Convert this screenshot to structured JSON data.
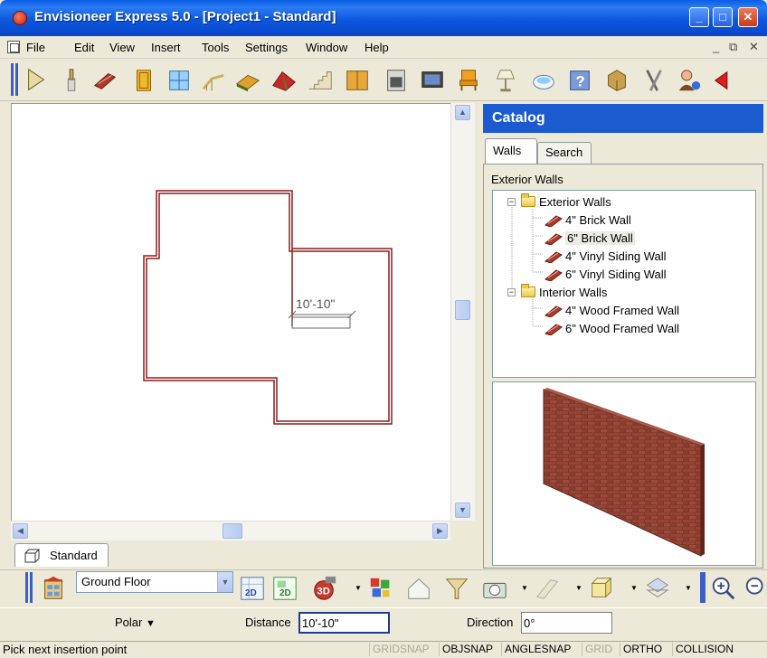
{
  "window": {
    "title": "Envisioneer Express 5.0 - [Project1 - Standard]",
    "minimize": "_",
    "maximize": "□",
    "close": "✕"
  },
  "menu": {
    "items": [
      "File",
      "Edit",
      "View",
      "Insert",
      "Tools",
      "Settings",
      "Window",
      "Help"
    ],
    "mdi_min": "_",
    "mdi_restore": "⧉",
    "mdi_close": "✕"
  },
  "toolbar": {
    "tools": [
      "select-arrow-icon",
      "paintbrush-icon",
      "brick-wall-icon",
      "door-icon",
      "window-icon",
      "railing-icon",
      "floor-icon",
      "roof-icon",
      "stairs-icon",
      "cabinet-icon",
      "appliance-icon",
      "electronics-icon",
      "chair-icon",
      "lamp-icon",
      "bath-icon",
      "help-icon",
      "material-icon",
      "trees-icon",
      "person-help-icon",
      "arrow-icon"
    ]
  },
  "canvas": {
    "dimension_label": "10'-10\""
  },
  "view_tab": {
    "label": "Standard"
  },
  "catalog": {
    "title": "Catalog",
    "tabs": [
      "Walls",
      "Search"
    ],
    "active_tab": "Walls",
    "caption": "Exterior Walls",
    "tree": [
      {
        "label": "Exterior Walls",
        "type": "folder",
        "expander": "−"
      },
      {
        "label": "4\" Brick Wall",
        "type": "item"
      },
      {
        "label": "6\" Brick Wall",
        "type": "item",
        "selected": true
      },
      {
        "label": "4\" Vinyl Siding Wall",
        "type": "item"
      },
      {
        "label": "6\" Vinyl Siding Wall",
        "type": "item"
      },
      {
        "label": "Interior Walls",
        "type": "folder",
        "expander": "−"
      },
      {
        "label": "4\" Wood Framed Wall",
        "type": "item"
      },
      {
        "label": "6\" Wood Framed Wall",
        "type": "item"
      }
    ]
  },
  "floorbar": {
    "floor_value": "Ground Floor",
    "tools": [
      "floor-stack-icon",
      "view-2d-icon",
      "view-2d-plan-icon",
      "camera-3d-icon",
      "render-icon",
      "house-outline-icon",
      "filter-icon",
      "camera-icon",
      "wall-display-icon",
      "box-display-icon",
      "layer-icon",
      "zoom-in-icon",
      "zoom-out-icon"
    ],
    "view_2d_label": "2D",
    "view_3d_label": "3D"
  },
  "inputbar": {
    "polar_label": "Polar",
    "polar_arrow": "▼",
    "distance_label": "Distance",
    "distance_value": "10'-10\"",
    "direction_label": "Direction",
    "direction_value": "0°"
  },
  "status": {
    "message": "Pick next insertion point",
    "indicators": [
      {
        "label": "GRIDSNAP",
        "on": false
      },
      {
        "label": "OBJSNAP",
        "on": true
      },
      {
        "label": "ANGLESNAP",
        "on": true
      },
      {
        "label": "GRID",
        "on": false
      },
      {
        "label": "ORTHO",
        "on": true
      },
      {
        "label": "COLLISION",
        "on": true
      }
    ]
  },
  "colors": {
    "title_bar": "#0a5ee5",
    "catalog_header": "#1c5ad0",
    "wall_stroke": "#8b1c1c",
    "brick": "#8a3a2c"
  }
}
